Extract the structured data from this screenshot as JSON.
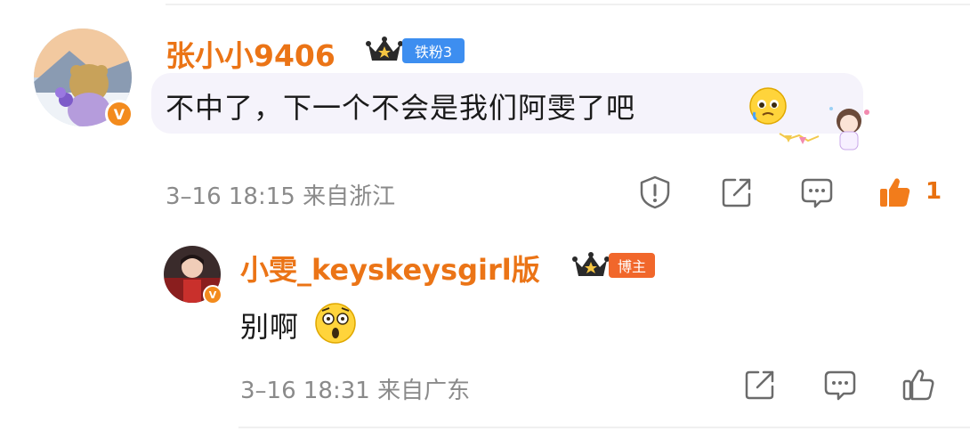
{
  "comment": {
    "username": "张小小9406",
    "badge": "铁粉3",
    "text": "不中了，下一个不会是我们阿雯了吧",
    "meta": "3–16 18:15 来自浙江",
    "like_count": "1",
    "emoji_icon": "pleading-face-icon",
    "sticker_icon": "anime-girl-sticker-icon",
    "verified_badge": "V"
  },
  "reply": {
    "username": "小雯_keyskeysgirl版",
    "badge": "博主",
    "text": "别啊",
    "meta": "3–16 18:31 来自广东",
    "emoji_icon": "astonished-face-icon",
    "verified_badge": "V"
  },
  "colors": {
    "username": "#eb7416",
    "fan_badge": "#3d8ef0",
    "author_badge": "#f1672b",
    "bubble": "#f5f3fb",
    "liked": "#e8700f",
    "meta": "#8a8a8a",
    "icon": "#6b6b6b"
  }
}
